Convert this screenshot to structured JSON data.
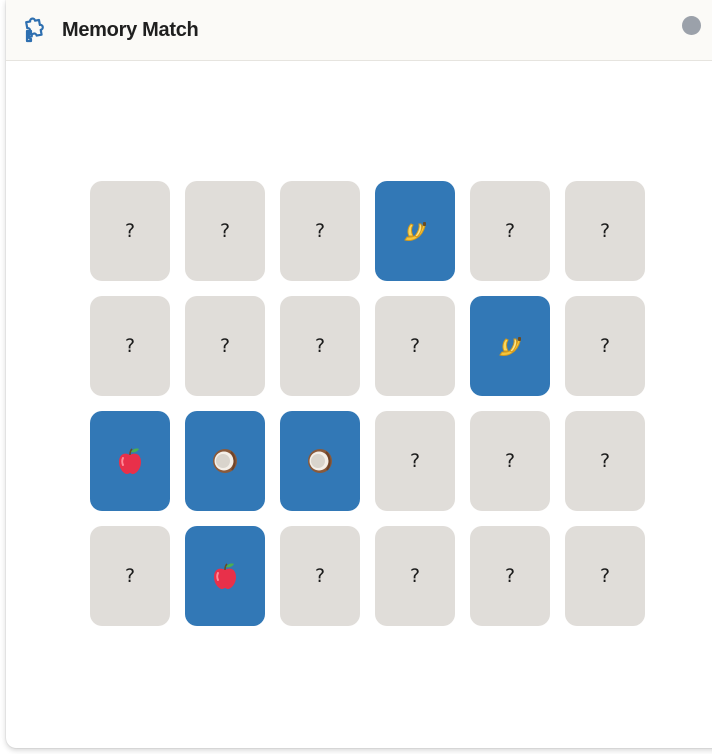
{
  "app": {
    "title": "Memory Match",
    "icon": "puzzle-icon"
  },
  "window_controls": {
    "close": "close-dot"
  },
  "colors": {
    "card_hidden": "#e0ddd9",
    "card_revealed": "#3278b6",
    "titlebar_bg": "#fbfaf7",
    "icon_blue": "#2e6fb0",
    "window_dot": "#9ba1aa"
  },
  "board": {
    "rows": 4,
    "columns": 6,
    "hidden_symbol": "?",
    "cards": [
      {
        "state": "hidden",
        "face": "?"
      },
      {
        "state": "hidden",
        "face": "?"
      },
      {
        "state": "hidden",
        "face": "?"
      },
      {
        "state": "revealed",
        "fruit": "banana"
      },
      {
        "state": "hidden",
        "face": "?"
      },
      {
        "state": "hidden",
        "face": "?"
      },
      {
        "state": "hidden",
        "face": "?"
      },
      {
        "state": "hidden",
        "face": "?"
      },
      {
        "state": "hidden",
        "face": "?"
      },
      {
        "state": "hidden",
        "face": "?"
      },
      {
        "state": "revealed",
        "fruit": "banana"
      },
      {
        "state": "hidden",
        "face": "?"
      },
      {
        "state": "revealed",
        "fruit": "apple"
      },
      {
        "state": "revealed",
        "fruit": "coconut"
      },
      {
        "state": "revealed",
        "fruit": "coconut"
      },
      {
        "state": "hidden",
        "face": "?"
      },
      {
        "state": "hidden",
        "face": "?"
      },
      {
        "state": "hidden",
        "face": "?"
      },
      {
        "state": "hidden",
        "face": "?"
      },
      {
        "state": "revealed",
        "fruit": "apple"
      },
      {
        "state": "hidden",
        "face": "?"
      },
      {
        "state": "hidden",
        "face": "?"
      },
      {
        "state": "hidden",
        "face": "?"
      },
      {
        "state": "hidden",
        "face": "?"
      }
    ]
  }
}
